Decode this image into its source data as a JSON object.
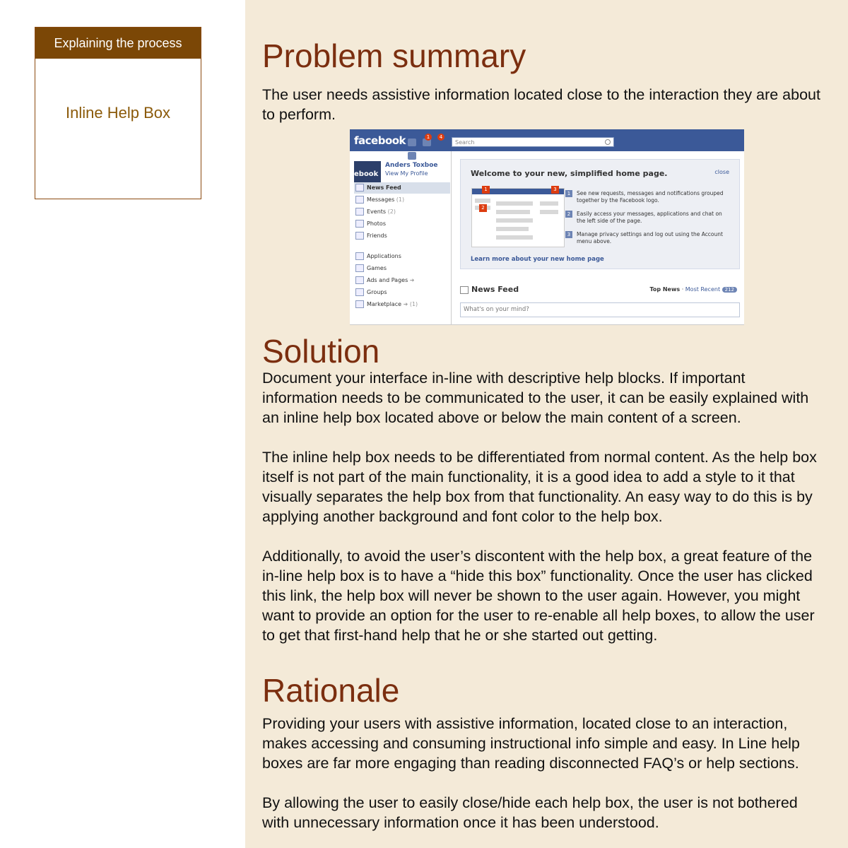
{
  "sidebar": {
    "header": "Explaining the process",
    "item": "Inline Help Box"
  },
  "sections": {
    "problem": {
      "title": "Problem summary",
      "text": "The user needs assistive information located close to the interaction they are about to perform."
    },
    "solution": {
      "title": "Solution",
      "paragraphs": [
        "Document your interface in-line with descriptive help blocks. If important information needs to be communicated to the user, it can be easily explained with an inline help box located above or below the main content of a screen.",
        "The inline help box needs to be differentiated from normal content. As the help box itself is not part of the main functionality, it is a good idea to add a style to it that visually separates the help box from that functionality. An easy way to do this is by applying another background and font color to the help box.",
        "Additionally, to avoid the user’s discontent with the help box, a great feature of the in-line help box is to have a “hide this box” functionality. Once the user has clicked this link, the help box will never be shown to the user again. However, you might want to provide an option for the user to re-enable all help boxes, to allow the user to get that first-hand help that he or she started out getting."
      ]
    },
    "rationale": {
      "title": "Rationale",
      "paragraphs": [
        "Providing your users with assistive information, located close to an interaction, makes accessing and consuming instructional info simple and easy. In Line help boxes are far more engaging than reading disconnected FAQ’s or help sections.",
        "By allowing the user to easily close/hide each help box, the user is not bothered with unnecessary information once it has been understood."
      ]
    }
  },
  "screenshot": {
    "logo": "facebook",
    "badges": [
      "1",
      "4"
    ],
    "search_placeholder": "Search",
    "avatar_text": "ebook",
    "user_name": "Anders Toxboe",
    "view_profile": "View My Profile",
    "nav": [
      {
        "label": "News Feed",
        "count": ""
      },
      {
        "label": "Messages",
        "count": "(1)"
      },
      {
        "label": "Events",
        "count": "(2)"
      },
      {
        "label": "Photos",
        "count": ""
      },
      {
        "label": "Friends",
        "count": ""
      },
      {
        "label": "Applications",
        "count": ""
      },
      {
        "label": "Games",
        "count": ""
      },
      {
        "label": "Ads and Pages",
        "count": "➜"
      },
      {
        "label": "Groups",
        "count": ""
      },
      {
        "label": "Marketplace",
        "count": "➜ (1)"
      }
    ],
    "help": {
      "title": "Welcome to your new, simplified home page.",
      "close": "close",
      "thumb_numbers": [
        "1",
        "2",
        "3"
      ],
      "steps": [
        {
          "num": "1",
          "text": "See new requests, messages and notifications grouped together by the Facebook logo."
        },
        {
          "num": "2",
          "text": "Easily access your messages, applications and chat on the left side of the page."
        },
        {
          "num": "3",
          "text": "Manage privacy settings and log out using the Account menu above."
        }
      ],
      "learn_more": "Learn more about your new home page"
    },
    "feed_title": "News Feed",
    "top_news": "Top News",
    "separator": "·",
    "most_recent": "Most Recent",
    "recent_count": "212",
    "status_placeholder": "What's on your mind?",
    "colors": {
      "brand": "#3b5998",
      "badge": "#dd3c10"
    }
  }
}
